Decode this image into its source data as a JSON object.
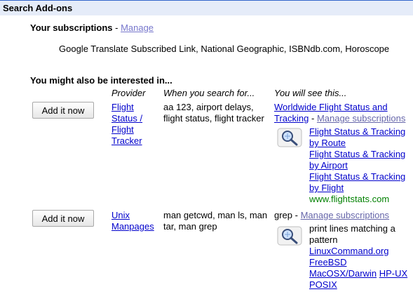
{
  "header": {
    "title": "Search Add-ons"
  },
  "subscriptions": {
    "label": "Your subscriptions",
    "separator": " - ",
    "manage_link": "Manage",
    "list": "Google Translate Subscribed Link, National Geographic, ISBNdb.com, Horoscope"
  },
  "suggestions": {
    "heading": "You might also be interested in...",
    "columns": {
      "provider": "Provider",
      "when": "When you search for...",
      "see": "You will see this..."
    },
    "rows": [
      {
        "button": "Add it now",
        "provider": [
          "Flight",
          "Status /",
          "Flight",
          "Tracker"
        ],
        "queries": [
          "aa 123, airport delays,",
          "flight status, flight tracker"
        ],
        "title_lines": [
          "Worldwide Flight Status and",
          "Tracking"
        ],
        "manage": "Manage subscriptions",
        "dash": " - ",
        "icon": "magnifier-globe-icon",
        "results": [
          [
            "Flight Status & Tracking",
            "by Route"
          ],
          [
            "Flight Status & Tracking",
            "by Airport"
          ],
          [
            "Flight Status & Tracking",
            "by Flight"
          ]
        ],
        "source": "www.flightstats.com"
      },
      {
        "button": "Add it now",
        "provider": [
          "Unix",
          "Manpages"
        ],
        "queries": [
          "man getcwd, man ls, man",
          "tar, man grep"
        ],
        "title": "grep",
        "dash": " - ",
        "manage": "Manage subscriptions",
        "icon": "magnifier-globe-icon",
        "description": [
          "print lines matching a",
          "pattern"
        ],
        "links": [
          "LinuxCommand.org",
          "FreeBSD",
          "MacOSX/Darwin",
          "HP-UX",
          "POSIX"
        ]
      }
    ]
  },
  "colors": {
    "header_bg": "#e5ecf9",
    "header_border": "#3366cc",
    "link": "#0000cc",
    "source": "#008000"
  }
}
